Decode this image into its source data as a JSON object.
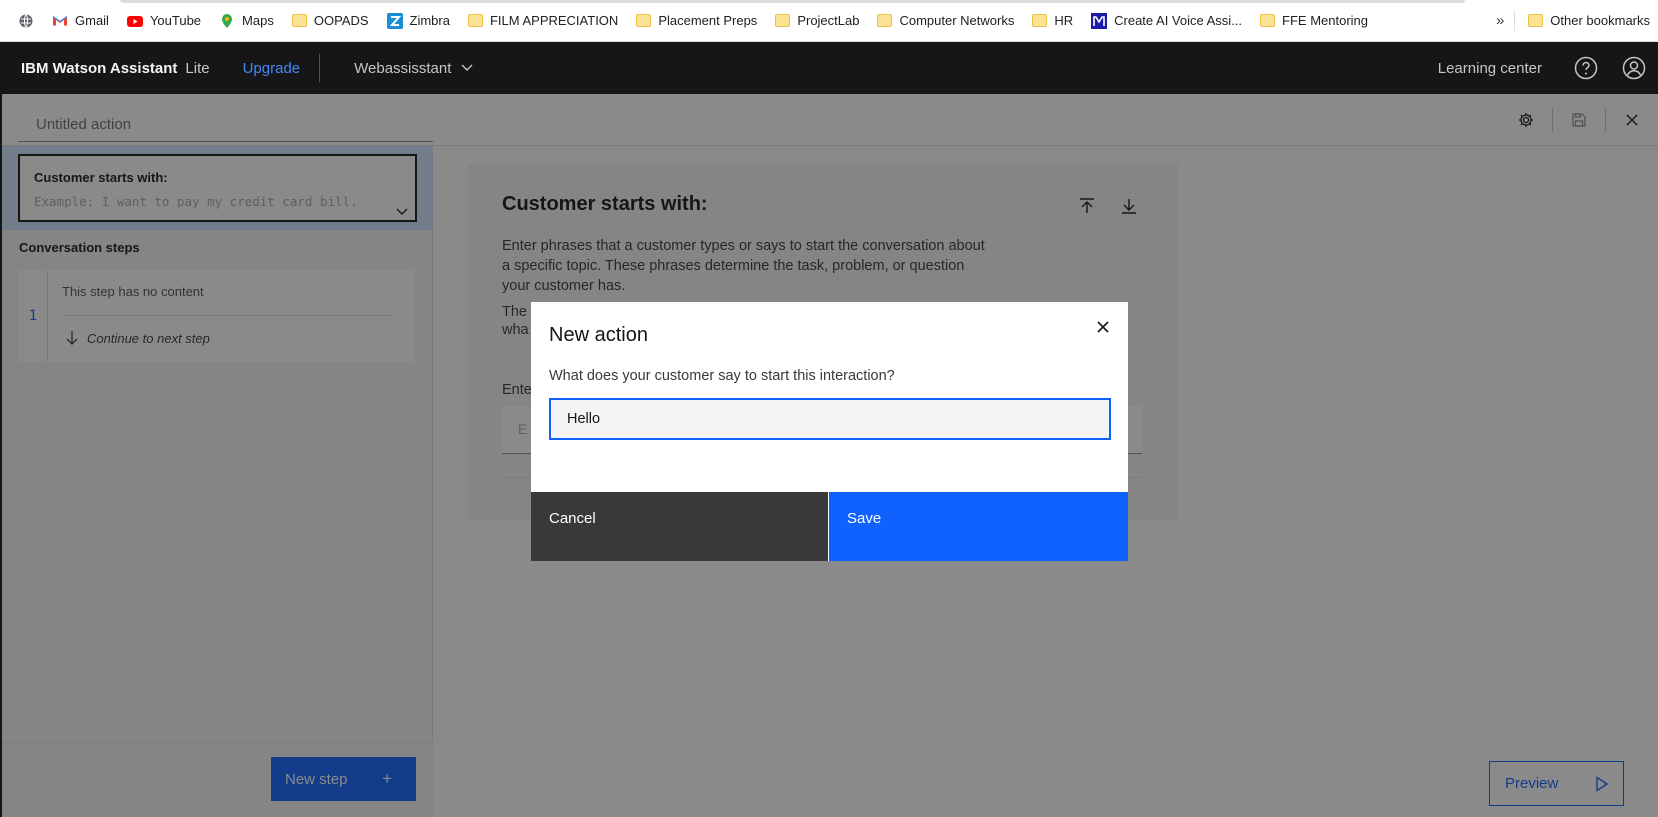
{
  "bookmarks": {
    "items": [
      {
        "label": "Gmail",
        "icon": "gmail-icon"
      },
      {
        "label": "YouTube",
        "icon": "youtube-icon"
      },
      {
        "label": "Maps",
        "icon": "maps-icon"
      },
      {
        "label": "OOPADS",
        "icon": "folder-icon"
      },
      {
        "label": "Zimbra",
        "icon": "zimbra-icon"
      },
      {
        "label": "FILM APPRECIATION",
        "icon": "folder-icon"
      },
      {
        "label": "Placement Preps",
        "icon": "folder-icon"
      },
      {
        "label": "ProjectLab",
        "icon": "folder-icon"
      },
      {
        "label": "Computer Networks",
        "icon": "folder-icon"
      },
      {
        "label": "HR",
        "icon": "folder-icon"
      },
      {
        "label": "Create AI Voice Assi...",
        "icon": "voice-app-icon"
      },
      {
        "label": "FFE Mentoring",
        "icon": "folder-icon"
      }
    ],
    "more": "»",
    "other": "Other bookmarks"
  },
  "header": {
    "brand": "IBM Watson Assistant",
    "plan": "Lite",
    "upgrade": "Upgrade",
    "assistant": "Webassisstant",
    "learning": "Learning center"
  },
  "titlebar": {
    "action_title": "Untitled action"
  },
  "sidebar": {
    "starts_title": "Customer starts with:",
    "starts_placeholder": "Example: I want to pay my credit card bill.",
    "conversation_steps": "Conversation steps",
    "step_number": "1",
    "step_empty": "This step has no content",
    "step_next": "Continue to next step",
    "new_step": "New step"
  },
  "main": {
    "title": "Customer starts with:",
    "description": "Enter phrases that a customer types or says to start the conversation about a specific topic. These phrases determine the task, problem, or question your customer has.",
    "description2_visible": "The\nwha",
    "label_visible": "Ente",
    "input_visible": "E",
    "preview": "Preview"
  },
  "modal": {
    "title": "New action",
    "label": "What does your customer say to start this interaction?",
    "input_value": "Hello",
    "cancel": "Cancel",
    "save": "Save"
  },
  "colors": {
    "primary": "#0f62fe",
    "header_bg": "#161616",
    "cancel_bg": "#393939"
  }
}
